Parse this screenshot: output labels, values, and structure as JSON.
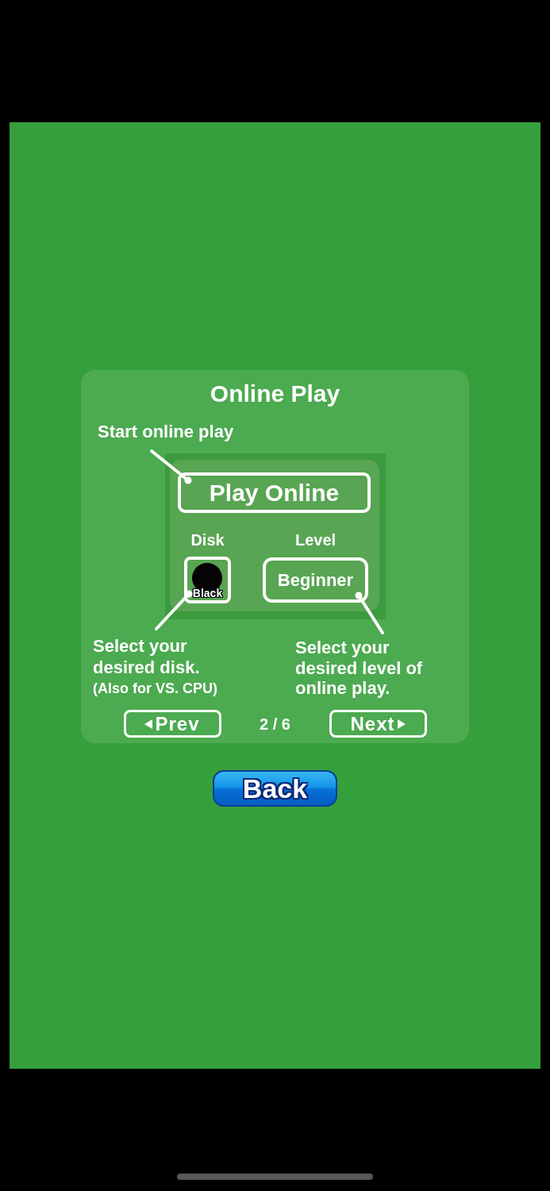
{
  "help_panel": {
    "title": "Online Play",
    "illustration": {
      "play_button": "Play Online",
      "disk_label": "Disk",
      "level_label": "Level",
      "disk_value": "Black",
      "level_value": "Beginner"
    },
    "callouts": {
      "play": "Start online play",
      "disk": "Select your\ndesired disk.",
      "disk_note": "(Also for VS. CPU)",
      "level": "Select your\ndesired level of\nonline play."
    },
    "pager": {
      "prev": "Prev",
      "page": "2 / 6",
      "next": "Next"
    }
  },
  "back_button": "Back"
}
